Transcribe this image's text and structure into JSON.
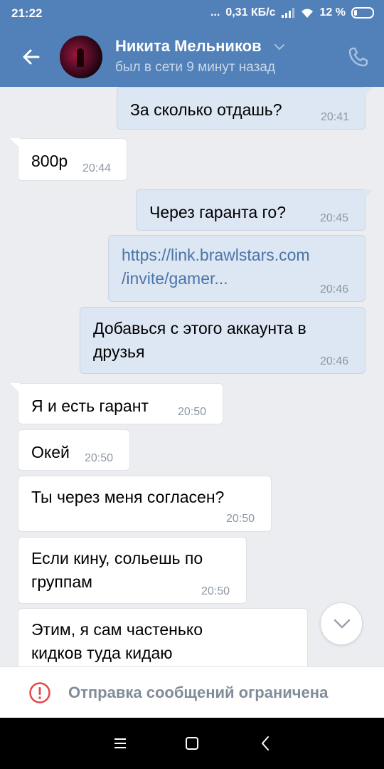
{
  "status_bar": {
    "time": "21:22",
    "dots": "...",
    "speed": "0,31 КБ/с",
    "battery": "12 %"
  },
  "header": {
    "contact_name": "Никита Мельников",
    "last_seen": "был в сети 9 минут назад",
    "icons": [
      "back-arrow-icon",
      "chevron-down-icon",
      "phone-icon"
    ]
  },
  "messages": [
    {
      "direction": "out",
      "text": "За сколько отдашь?",
      "time": "20:41"
    },
    {
      "direction": "in",
      "text": "800р",
      "time": "20:44"
    },
    {
      "direction": "out",
      "text": "Через гаранта го?",
      "time": "20:45"
    },
    {
      "direction": "out",
      "text": "https://link.brawlstars.com\n/invite/gamer...",
      "time": "20:46",
      "is_link": true
    },
    {
      "direction": "out",
      "text": "Добавься с этого аккаунта в\nдрузья",
      "time": "20:46"
    },
    {
      "direction": "in",
      "text": "Я и есть гарант",
      "time": "20:50"
    },
    {
      "direction": "in",
      "text": "Окей",
      "time": "20:50"
    },
    {
      "direction": "in",
      "text": "Ты через меня согласен?",
      "time": "20:50"
    },
    {
      "direction": "in",
      "text": "Если кину, сольешь по\nгруппам",
      "time": "20:50"
    },
    {
      "direction": "in",
      "text": "Этим, я сам частенько\nкидков туда кидаю",
      "time": ""
    }
  ],
  "restriction": {
    "label": "Отправка сообщений ограничена",
    "icon": "warning-circle-icon",
    "color": "#e64646"
  },
  "colors": {
    "header": "#5181b8",
    "incoming_bubble": "#ffffff",
    "outgoing_bubble": "#dde6f3",
    "background": "#ebedf0",
    "link": "#4a74a8"
  }
}
